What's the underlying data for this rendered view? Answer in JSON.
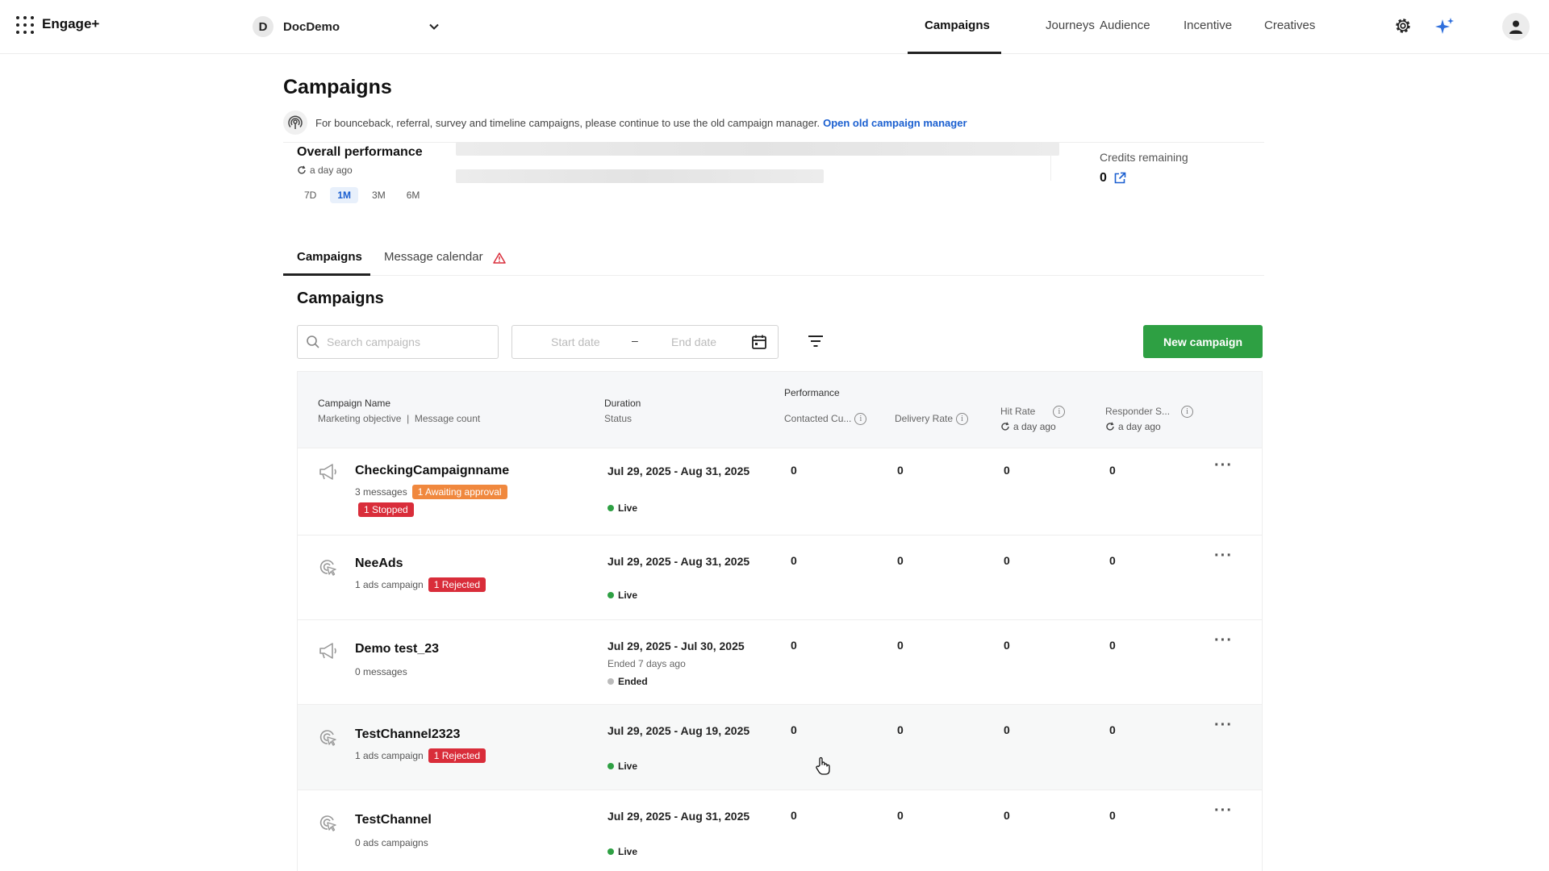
{
  "app": {
    "name": "Engage+"
  },
  "workspace": {
    "initial": "D",
    "name": "DocDemo"
  },
  "nav": {
    "items": [
      {
        "label": "Campaigns",
        "active": true
      },
      {
        "label": "Journeys"
      },
      {
        "label": "Audience"
      },
      {
        "label": "Incentive"
      },
      {
        "label": "Creatives"
      }
    ]
  },
  "page": {
    "title": "Campaigns",
    "notice_text": "For bounceback, referral, survey and timeline campaigns, please continue to use the old campaign manager.",
    "notice_link": "Open old campaign manager"
  },
  "performance": {
    "title": "Overall performance",
    "updated": "a day ago",
    "ranges": [
      "7D",
      "1M",
      "3M",
      "6M"
    ],
    "active_range": "1M",
    "credits_label": "Credits remaining",
    "credits_value": "0"
  },
  "tabs": [
    {
      "label": "Campaigns",
      "active": true
    },
    {
      "label": "Message calendar",
      "warning": true
    }
  ],
  "section": {
    "title": "Campaigns",
    "search_placeholder": "Search campaigns",
    "start_date_placeholder": "Start date",
    "date_separator": "–",
    "end_date_placeholder": "End date",
    "new_button": "New campaign"
  },
  "table": {
    "headers": {
      "name": "Campaign Name",
      "objective": "Marketing objective",
      "sep": "|",
      "message_count": "Message count",
      "duration": "Duration",
      "status": "Status",
      "performance": "Performance",
      "contacted": "Contacted Cu...",
      "delivery": "Delivery Rate",
      "hit_rate": "Hit Rate",
      "hit_rate_updated": "a day ago",
      "responder": "Responder S...",
      "responder_updated": "a day ago"
    },
    "rows": [
      {
        "icon": "megaphone-icon",
        "name": "CheckingCampaignname",
        "meta": "3 messages",
        "badges": [
          {
            "text": "1 Awaiting approval",
            "color": "#f0883e"
          }
        ],
        "badge2": {
          "text": "1 Stopped",
          "color": "#d92d3a"
        },
        "duration": "Jul 29, 2025 - Aug 31, 2025",
        "status": "Live",
        "contacted": "0",
        "delivery": "0",
        "hit_rate": "0",
        "responder": "0"
      },
      {
        "icon": "target-icon",
        "name": "NeeAds",
        "meta": "1 ads campaign",
        "badges": [
          {
            "text": "1 Rejected",
            "color": "#d92d3a"
          }
        ],
        "duration": "Jul 29, 2025 - Aug 31, 2025",
        "status": "Live",
        "contacted": "0",
        "delivery": "0",
        "hit_rate": "0",
        "responder": "0"
      },
      {
        "icon": "megaphone-icon",
        "name": "Demo test_23",
        "meta": "0 messages",
        "duration": "Jul 29, 2025 - Jul 30, 2025",
        "ended_note": "Ended 7 days ago",
        "status": "Ended",
        "contacted": "0",
        "delivery": "0",
        "hit_rate": "0",
        "responder": "0"
      },
      {
        "icon": "target-icon",
        "name": "TestChannel2323",
        "meta": "1 ads campaign",
        "badges": [
          {
            "text": "1 Rejected",
            "color": "#d92d3a"
          }
        ],
        "duration": "Jul 29, 2025 - Aug 19, 2025",
        "status": "Live",
        "contacted": "0",
        "delivery": "0",
        "hit_rate": "0",
        "responder": "0",
        "hovered": true
      },
      {
        "icon": "target-icon",
        "name": "TestChannel",
        "meta": "0 ads campaigns",
        "duration": "Jul 29, 2025 - Aug 31, 2025",
        "status": "Live",
        "contacted": "0",
        "delivery": "0",
        "hit_rate": "0",
        "responder": "0"
      }
    ]
  },
  "colors": {
    "primary_button": "#2ea043",
    "link": "#1a5fd0",
    "live_dot": "#2ea043"
  }
}
